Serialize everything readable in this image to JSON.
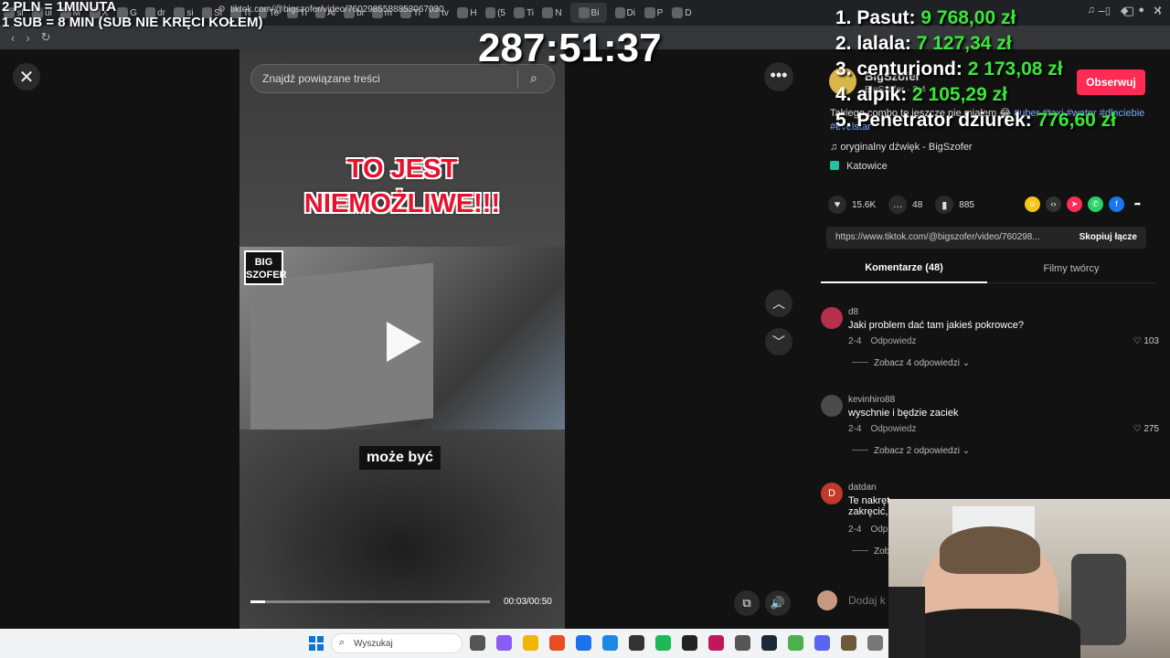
{
  "browser": {
    "tab_labels": [
      "sl",
      "ul",
      "M",
      "X",
      "G",
      "dr",
      "si",
      "Sl",
      "Ti",
      "Te",
      "Ti",
      "Ai",
      "bi",
      "m",
      "Ti",
      "tv",
      "H",
      "(5",
      "Ti",
      "N",
      "Bi",
      "Di",
      "P",
      "D"
    ],
    "url": "tiktok.com/@bigszofer/video/7602985588853067030"
  },
  "overlay": {
    "price_line1": "2 PLN = 1MINUTA",
    "price_line2": "1 SUB = 8 MIN (SUB NIE KRĘCI KOŁEM)",
    "timer": "287:51:37",
    "leaderboard": [
      {
        "rank": "1.",
        "name": "Pasut:",
        "amount": "9 768,00 zł"
      },
      {
        "rank": "2.",
        "name": "lalala:",
        "amount": "7 127,34 zł"
      },
      {
        "rank": "3.",
        "name": "centuriond:",
        "amount": "2 173,08 zł"
      },
      {
        "rank": "4.",
        "name": "alpik:",
        "amount": "2 105,29 zł"
      },
      {
        "rank": "5.",
        "name": "Penetrator dziurek:",
        "amount": "776,60 zł"
      }
    ]
  },
  "player": {
    "search_placeholder": "Znajdź powiązane treści",
    "headline_line1": "TO JEST",
    "headline_line2": "NIEMOŻLIWE!!!",
    "logo_line1": "BIG",
    "logo_line2": "SZOFER",
    "subtitle": "może być",
    "time": "00:03/00:50",
    "progress": 0.06
  },
  "post": {
    "author": "BigSzofer",
    "author_sub": "BigSzofer · 2-4",
    "follow_label": "Obserwuj",
    "description": "Takiego combo to jeszcze nie miałem 😂",
    "tags": [
      "#uber",
      "#taxi",
      "#water",
      "#dlaciebie",
      "#evelstar"
    ],
    "music": "oryginalny dźwięk - BigSzofer",
    "location": "Katowice",
    "likes": "15.6K",
    "comments": "48",
    "saves": "885",
    "link": "https://www.tiktok.com/@bigszofer/video/760298...",
    "copy_label": "Skopiuj łącze"
  },
  "tabs": {
    "comments": "Komentarze (48)",
    "creator_videos": "Filmy twórcy"
  },
  "comments": [
    {
      "user": "d8",
      "text": "Jaki problem dać tam jakieś pokrowce?",
      "date": "2-4",
      "reply": "Odpowiedz",
      "likes": "103",
      "more": "Zobacz 4 odpowiedzi",
      "avatar_color": "#b5304a",
      "avatar_letter": ""
    },
    {
      "user": "kevinhiro88",
      "text": "wyschnie i będzie zaciek",
      "date": "2-4",
      "reply": "Odpowiedz",
      "likes": "275",
      "more": "Zobacz 2 odpowiedzi",
      "avatar_color": "#4a4a4a",
      "avatar_letter": ""
    },
    {
      "user": "datdan",
      "text": "Te nakręt",
      "text2": "zakręcić,",
      "date": "2-4",
      "reply": "Odp",
      "likes": "",
      "more": "Zob",
      "avatar_color": "#c0392b",
      "avatar_letter": "D"
    }
  ],
  "add_comment_placeholder": "Dodaj k",
  "taskbar": {
    "search_label": "Wyszukaj",
    "app_colors": [
      "#555",
      "#8a5cf6",
      "#f2b600",
      "#e84c22",
      "#1a73e8",
      "#1e88e5",
      "#333",
      "#1db954",
      "#222",
      "#c2185b",
      "#555",
      "#1b2838",
      "#4caf50",
      "#5865f2",
      "#6d5a3b",
      "#777"
    ]
  }
}
